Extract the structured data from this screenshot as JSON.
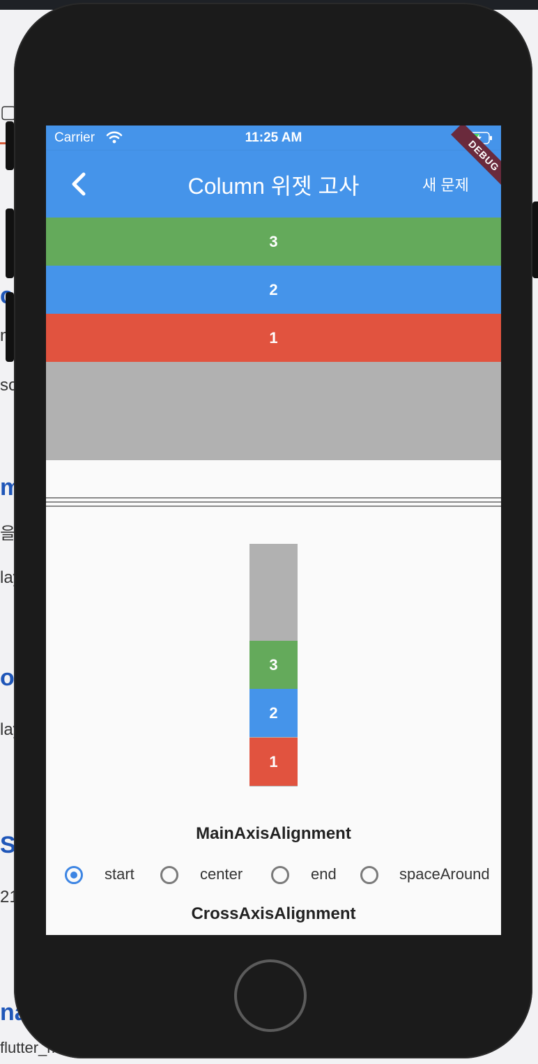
{
  "background": {
    "snippets": [
      "m",
      "so",
      "을",
      "lay",
      "ol",
      "lay",
      "S_",
      "21",
      "nal",
      "flutter_m"
    ],
    "blue_fragments": [
      "c",
      "m",
      "ol",
      "S_",
      "nal"
    ]
  },
  "status_bar": {
    "carrier": "Carrier",
    "time": "11:25 AM"
  },
  "app_bar": {
    "title": "Column 위젯 고사",
    "action_label": "새 문제",
    "debug_label": "DEBUG"
  },
  "answer_bars": [
    {
      "label": "3",
      "color": "#64aa5b"
    },
    {
      "label": "2",
      "color": "#4594ea"
    },
    {
      "label": "1",
      "color": "#e1533f"
    }
  ],
  "stack_cells": [
    {
      "label": "3",
      "color": "#64aa5b"
    },
    {
      "label": "2",
      "color": "#4594ea"
    },
    {
      "label": "1",
      "color": "#e1533f"
    }
  ],
  "main_axis": {
    "label": "MainAxisAlignment",
    "options": [
      "start",
      "center",
      "end",
      "spaceAround"
    ],
    "selected": "start"
  },
  "cross_axis": {
    "label": "CrossAxisAlignment"
  },
  "colors": {
    "app_blue": "#4594ea",
    "radio_active": "#3d85e3"
  }
}
